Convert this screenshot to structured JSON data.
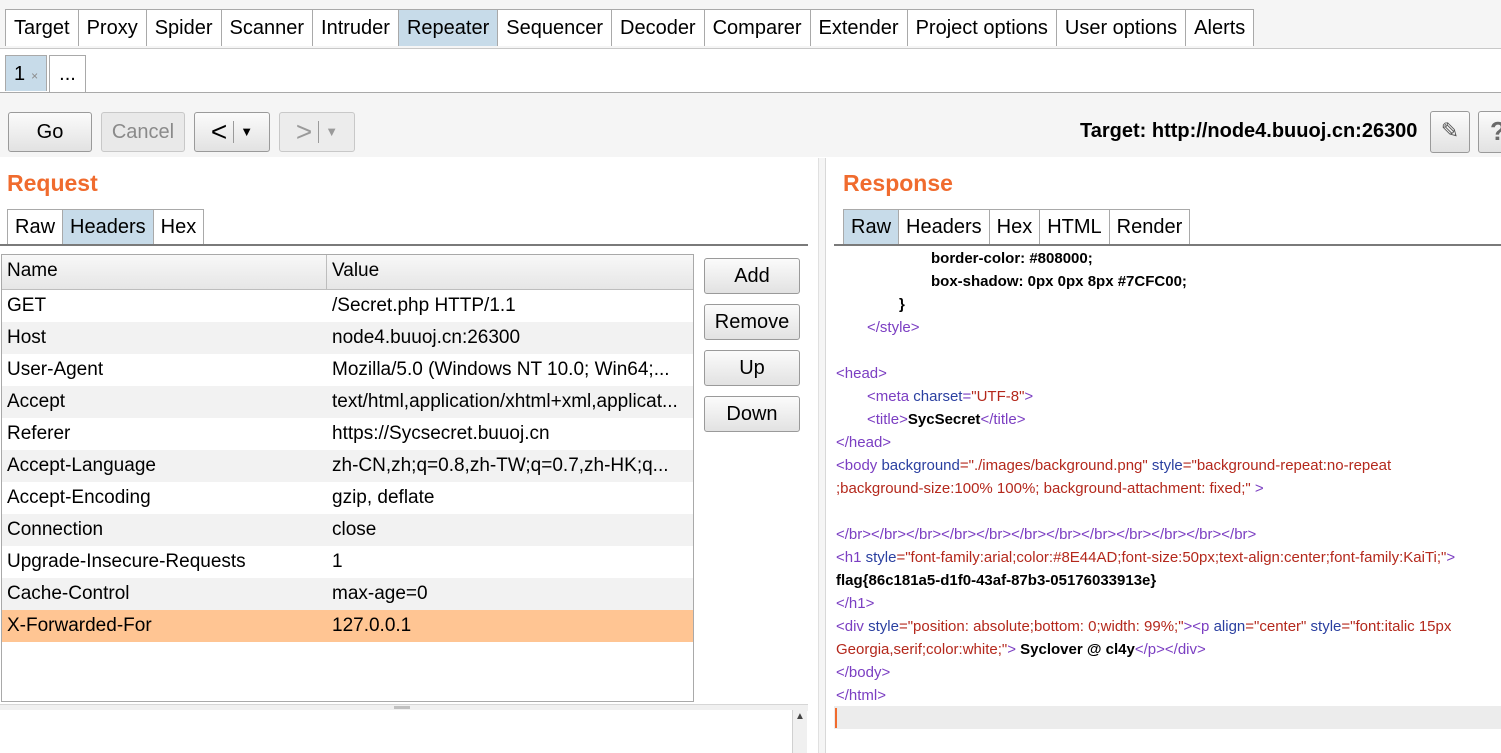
{
  "main_tabs": [
    "Target",
    "Proxy",
    "Spider",
    "Scanner",
    "Intruder",
    "Repeater",
    "Sequencer",
    "Decoder",
    "Comparer",
    "Extender",
    "Project options",
    "User options",
    "Alerts"
  ],
  "active_main_tab": "Repeater",
  "sub_tabs": {
    "first": "1",
    "first_close": "×",
    "more": "..."
  },
  "toolbar": {
    "go": "Go",
    "cancel": "Cancel",
    "back_arrow": "<",
    "forward_arrow": ">",
    "dropdown": "▼",
    "target": "Target: http://node4.buuoj.cn:26300",
    "edit_icon": "✎",
    "help": "?"
  },
  "request": {
    "title": "Request",
    "tabs": [
      "Raw",
      "Headers",
      "Hex"
    ],
    "active_tab": "Headers",
    "columns": {
      "name": "Name",
      "value": "Value"
    },
    "rows": [
      {
        "name": "GET",
        "value": "/Secret.php HTTP/1.1"
      },
      {
        "name": "Host",
        "value": "node4.buuoj.cn:26300"
      },
      {
        "name": "User-Agent",
        "value": "Mozilla/5.0 (Windows NT 10.0; Win64;..."
      },
      {
        "name": "Accept",
        "value": "text/html,application/xhtml+xml,applicat..."
      },
      {
        "name": "Referer",
        "value": "https://Sycsecret.buuoj.cn"
      },
      {
        "name": "Accept-Language",
        "value": "zh-CN,zh;q=0.8,zh-TW;q=0.7,zh-HK;q..."
      },
      {
        "name": "Accept-Encoding",
        "value": "gzip, deflate"
      },
      {
        "name": "Connection",
        "value": "close"
      },
      {
        "name": "Upgrade-Insecure-Requests",
        "value": "1"
      },
      {
        "name": "Cache-Control",
        "value": "max-age=0"
      },
      {
        "name": "X-Forwarded-For",
        "value": "127.0.0.1"
      }
    ],
    "selected_row": "X-Forwarded-For",
    "buttons": {
      "add": "Add",
      "remove": "Remove",
      "up": "Up",
      "down": "Down"
    }
  },
  "response": {
    "title": "Response",
    "tabs": [
      "Raw",
      "Headers",
      "Hex",
      "HTML",
      "Render"
    ],
    "active_tab": "Raw",
    "code": {
      "l1": "border-color: #808000;",
      "l2": "box-shadow: 0px 0px 8px #7CFC00;",
      "l3": "}",
      "l4": "</style>",
      "l5": "<head>",
      "l6_tag_open": "<meta ",
      "l6_attr": "charset",
      "l6_eq": "=",
      "l6_val": "\"UTF-8\"",
      "l6_close": ">",
      "l7_open": "<title>",
      "l7_text": "SycSecret",
      "l7_close": "</title>",
      "l8": "</head>",
      "l9_open": "<body ",
      "l9_attr1": "background",
      "l9_val1": "=\"./images/background.png\" ",
      "l9_attr2": "style",
      "l9_val2": "=\"background-repeat:no-repeat",
      "l10_val": ";background-size:100% 100%; background-attachment: fixed;\" ",
      "l10_close": ">",
      "l11": "</br></br></br></br></br></br></br></br></br></br></br></br>",
      "l12_open": "<h1 ",
      "l12_attr": "style",
      "l12_val": "=\"font-family:arial;color:#8E44AD;font-size:50px;text-align:center;font-family:KaiTi;\"",
      "l12_close": ">",
      "l13": "flag{86c181a5-d1f0-43af-87b3-05176033913e}",
      "l14": "</h1>",
      "l15_open": "<div ",
      "l15_attr1": "style",
      "l15_val1": "=\"position: absolute;bottom: 0;width: 99%;\"",
      "l15_mid": "><p ",
      "l15_attr2": "align",
      "l15_val2": "=\"center\" ",
      "l15_attr3": "style",
      "l15_val3": "=\"font:italic 15px",
      "l16_val": "Georgia,serif;color:white;\"",
      "l16_gt": ">",
      "l16_text": " Syclover @ cl4y",
      "l16_close": "</p></div>",
      "l17": "</body>",
      "l18": "</html>"
    }
  }
}
